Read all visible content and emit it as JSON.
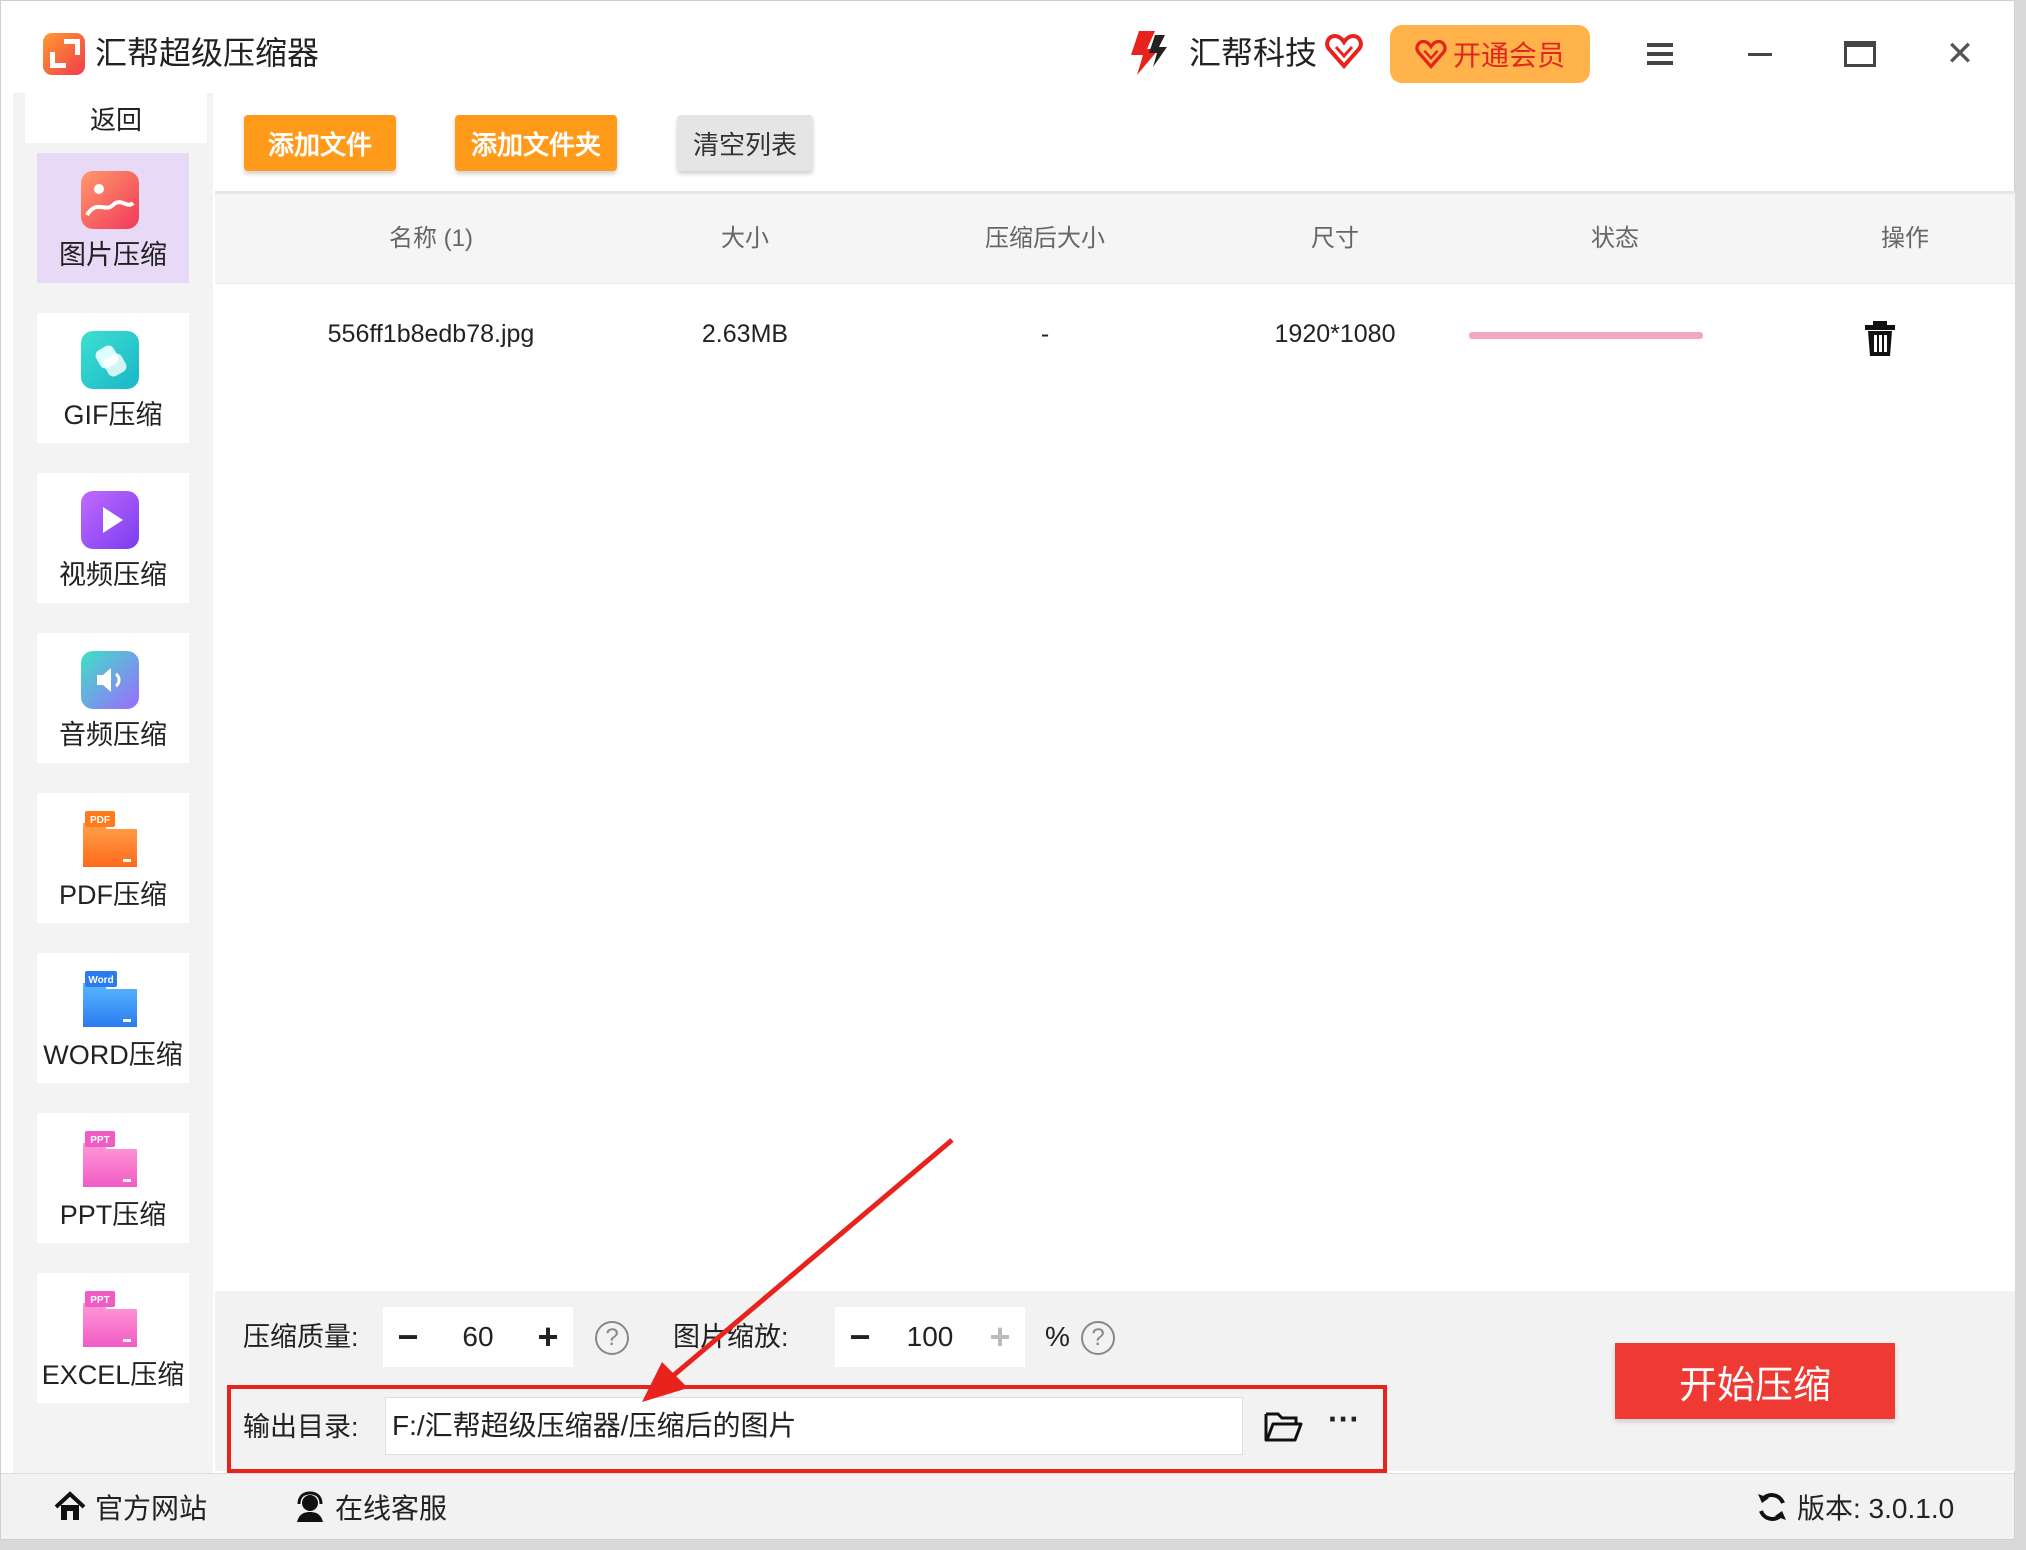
{
  "app": {
    "title": "汇帮超级压缩器",
    "brand": "汇帮科技",
    "vip_label": "开通会员"
  },
  "sidebar": {
    "back_label": "返回",
    "items": [
      {
        "label": "图片压缩",
        "icon": "image-icon",
        "active": true
      },
      {
        "label": "GIF压缩",
        "icon": "gif-icon",
        "active": false
      },
      {
        "label": "视频压缩",
        "icon": "video-icon",
        "active": false
      },
      {
        "label": "音频压缩",
        "icon": "audio-icon",
        "active": false
      },
      {
        "label": "PDF压缩",
        "icon": "pdf-icon",
        "active": false,
        "badge": "PDF"
      },
      {
        "label": "WORD压缩",
        "icon": "word-icon",
        "active": false,
        "badge": "Word"
      },
      {
        "label": "PPT压缩",
        "icon": "ppt-icon",
        "active": false,
        "badge": "PPT"
      },
      {
        "label": "EXCEL压缩",
        "icon": "excel-icon",
        "active": false,
        "badge": "PPT"
      }
    ]
  },
  "toolbar": {
    "add_file": "添加文件",
    "add_folder": "添加文件夹",
    "clear_list": "清空列表"
  },
  "table": {
    "headers": [
      "名称 (1)",
      "大小",
      "压缩后大小",
      "尺寸",
      "状态",
      "操作"
    ],
    "rows": [
      {
        "name": "556ff1b8edb78.jpg",
        "size": "2.63MB",
        "compressed_size": "-",
        "dimensions": "1920*1080",
        "progress": 1.0
      }
    ]
  },
  "settings": {
    "quality_label": "压缩质量:",
    "quality_value": "60",
    "scale_label": "图片缩放:",
    "scale_value": "100",
    "scale_unit": "%",
    "output_label": "输出目录:",
    "output_path": "F:/汇帮超级压缩器/压缩后的图片",
    "more_label": "···"
  },
  "start_label": "开始压缩",
  "footer": {
    "site": "官方网站",
    "service": "在线客服",
    "version": "版本: 3.0.1.0"
  },
  "colors": {
    "accent_orange": "#ff9a1a",
    "start_red": "#ef3a33",
    "highlight_red": "#e8231d",
    "active_nav": "#e8d9f6"
  }
}
